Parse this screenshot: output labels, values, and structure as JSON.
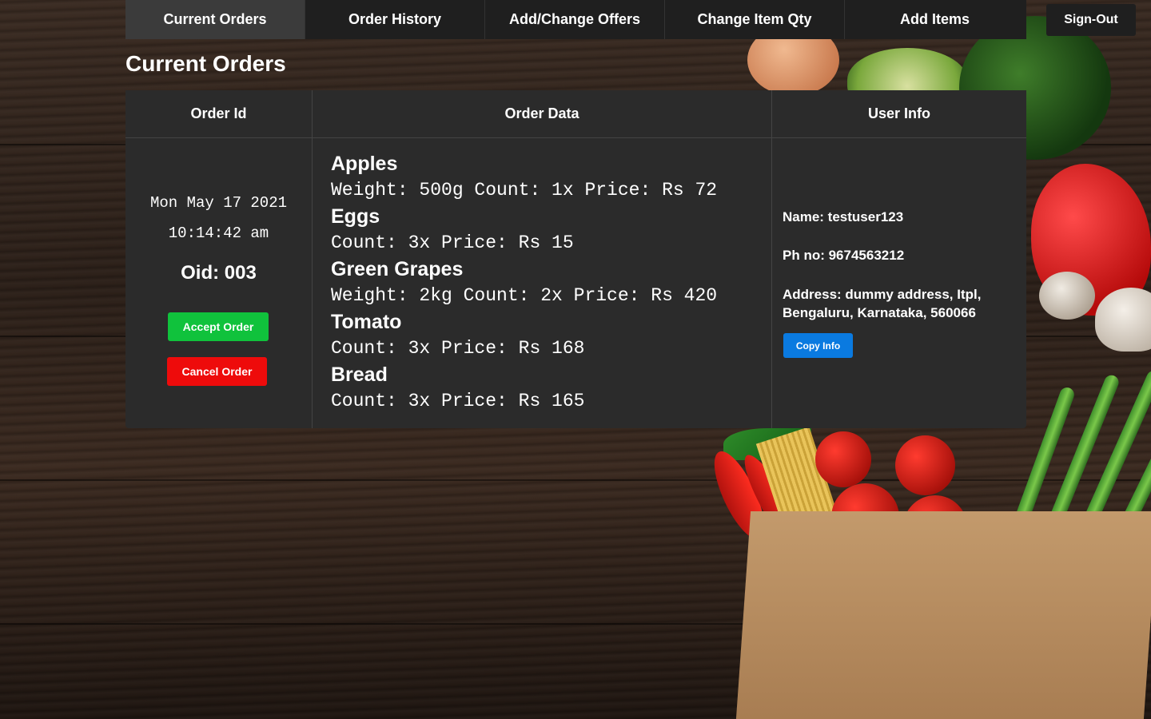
{
  "nav": {
    "tabs": [
      {
        "label": "Current Orders"
      },
      {
        "label": "Order History"
      },
      {
        "label": "Add/Change Offers"
      },
      {
        "label": "Change Item Qty"
      },
      {
        "label": "Add Items"
      }
    ],
    "active_tab": "Current Orders",
    "signout_label": "Sign-Out"
  },
  "page": {
    "title": "Current Orders"
  },
  "table": {
    "headers": [
      "Order Id",
      "Order Data",
      "User Info"
    ],
    "orders": [
      {
        "date_line": "Mon May 17 2021",
        "time_line": "10:14:42 am",
        "oid": "Oid: 003",
        "accept_label": "Accept Order",
        "cancel_label": "Cancel Order",
        "items": [
          {
            "name": "Apples",
            "detail": "Weight: 500g Count: 1x Price: Rs 72"
          },
          {
            "name": "Eggs",
            "detail": "Count: 3x Price: Rs 15"
          },
          {
            "name": "Green Grapes",
            "detail": "Weight: 2kg Count: 2x Price: Rs 420"
          },
          {
            "name": "Tomato",
            "detail": "Count: 3x Price: Rs 168"
          },
          {
            "name": "Bread",
            "detail": "Count: 3x Price: Rs 165"
          }
        ],
        "user": {
          "name": "Name: testuser123",
          "phone": "Ph no: 9674563212",
          "address": "Address: dummy address, Itpl, Bengaluru, Karnataka, 560066",
          "copy_label": "Copy Info"
        }
      }
    ]
  },
  "colors": {
    "accept": "#10c23c",
    "cancel": "#ee0b0b",
    "copy": "#0a7ae0",
    "panel": "#2b2b2b",
    "nav": "#1f1f1f",
    "nav_active": "#3b3b3b"
  }
}
